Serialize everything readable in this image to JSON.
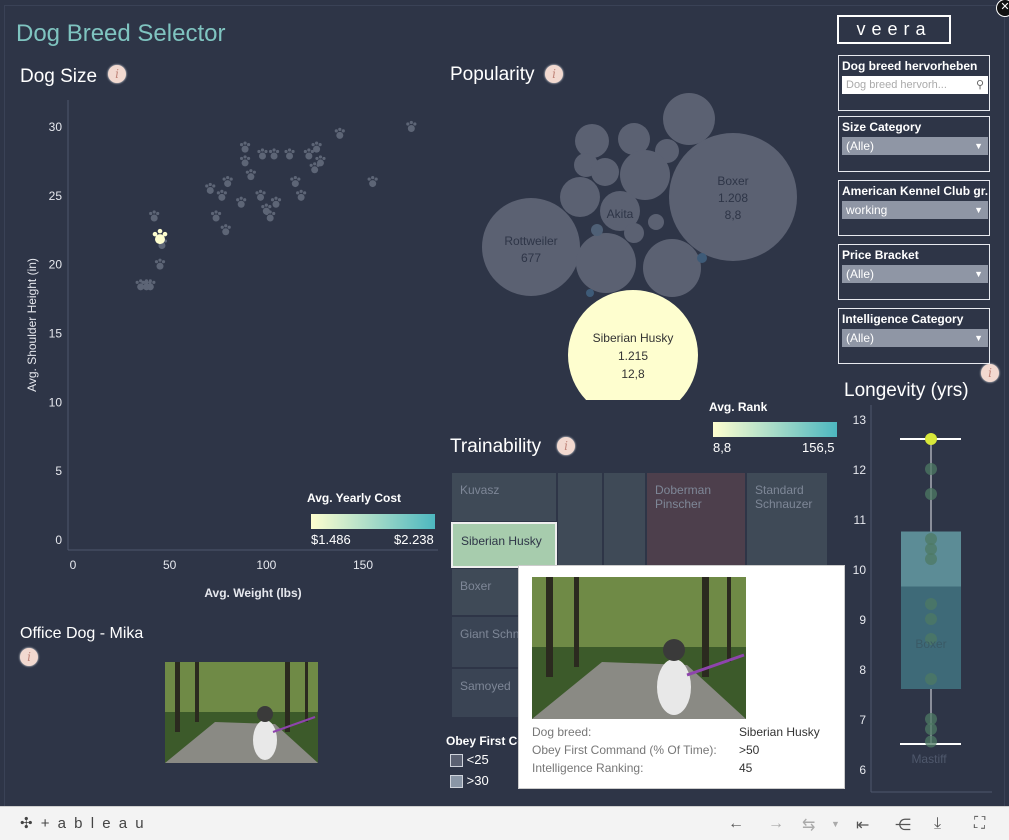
{
  "dashboard": {
    "title": "Dog Breed Selector",
    "logo": "veera"
  },
  "dog_size": {
    "title": "Dog Size",
    "info_icon": "i",
    "xlabel": "Avg. Weight (lbs)",
    "ylabel": "Avg. Shoulder Height (in)",
    "x_ticks": [
      "0",
      "50",
      "100",
      "150"
    ],
    "y_ticks": [
      "0",
      "5",
      "10",
      "15",
      "20",
      "25",
      "30"
    ],
    "legend_title": "Avg. Yearly Cost",
    "legend_min": "$1.486",
    "legend_max": "$2.238"
  },
  "chart_data": [
    {
      "type": "scatter",
      "xlabel": "Avg. Weight (lbs)",
      "ylabel": "Avg. Shoulder Height (in)",
      "xlim": [
        0,
        185
      ],
      "ylim": [
        0,
        31
      ],
      "highlighted": {
        "x": 45,
        "y": 22
      },
      "points": [
        {
          "x": 35,
          "y": 18.5
        },
        {
          "x": 38,
          "y": 18.5
        },
        {
          "x": 40,
          "y": 18.5
        },
        {
          "x": 45,
          "y": 20
        },
        {
          "x": 46,
          "y": 21.5
        },
        {
          "x": 42,
          "y": 23.5
        },
        {
          "x": 74,
          "y": 23.5
        },
        {
          "x": 77,
          "y": 25
        },
        {
          "x": 80,
          "y": 26
        },
        {
          "x": 79,
          "y": 22.5
        },
        {
          "x": 87,
          "y": 24.5
        },
        {
          "x": 92,
          "y": 26.5
        },
        {
          "x": 97,
          "y": 25
        },
        {
          "x": 100,
          "y": 24
        },
        {
          "x": 102,
          "y": 23.5
        },
        {
          "x": 105,
          "y": 24.5
        },
        {
          "x": 98,
          "y": 28
        },
        {
          "x": 104,
          "y": 28
        },
        {
          "x": 89,
          "y": 28.5
        },
        {
          "x": 89,
          "y": 27.5
        },
        {
          "x": 112,
          "y": 28
        },
        {
          "x": 115,
          "y": 26
        },
        {
          "x": 118,
          "y": 25
        },
        {
          "x": 122,
          "y": 28
        },
        {
          "x": 125,
          "y": 27
        },
        {
          "x": 128,
          "y": 27.5
        },
        {
          "x": 126,
          "y": 28.5
        },
        {
          "x": 138,
          "y": 29.5
        },
        {
          "x": 155,
          "y": 26
        },
        {
          "x": 175,
          "y": 30
        },
        {
          "x": 71,
          "y": 25.5
        }
      ]
    },
    {
      "type": "bubble",
      "title": "Popularity",
      "color_legend": "Avg. Rank",
      "color_min": "8,8",
      "color_max": "156,5",
      "labeled": [
        {
          "name": "Boxer",
          "value": "1.208",
          "rank": "8,8"
        },
        {
          "name": "Rottweiler",
          "value": "677"
        },
        {
          "name": "Akita"
        },
        {
          "name": "Siberian Husky",
          "value": "1.215",
          "rank": "12,8"
        }
      ]
    },
    {
      "type": "box",
      "title": "Longevity (yrs)",
      "ylim": [
        5.7,
        13.1
      ],
      "y_ticks": [
        "6",
        "7",
        "8",
        "9",
        "10",
        "11",
        "12",
        "13"
      ],
      "whisker_low": 6.5,
      "whisker_high": 12.6,
      "q1": 7.6,
      "median": 9.65,
      "q3": 10.75,
      "highlighted": 12.6,
      "points": [
        6.55,
        6.8,
        7.0,
        7.8,
        8.6,
        9.0,
        9.3,
        10.2,
        10.4,
        10.6,
        11.5,
        12.0
      ],
      "labels": [
        "Boxer",
        "Mastiff"
      ]
    }
  ],
  "popularity": {
    "title": "Popularity",
    "info_icon": "i",
    "legend_title": "Avg. Rank",
    "legend_min": "8,8",
    "legend_max": "156,5"
  },
  "trainability": {
    "title": "Trainability",
    "info_icon": "i",
    "cells": [
      "Kuvasz",
      "Doberman Pinscher",
      "Standard Schnauzer",
      "Siberian Husky",
      "Boxer",
      "Giant Schn",
      "Samoyed"
    ],
    "legend_title": "Obey First Co",
    "legend_items": [
      "<25",
      ">30"
    ]
  },
  "longevity": {
    "title": "Longevity (yrs)",
    "info_icon": "i"
  },
  "office_dog": {
    "title": "Office Dog - Mika",
    "info_icon": "i"
  },
  "filters": [
    {
      "label": "Dog breed hervorheben",
      "placeholder": "Dog breed hervorh...",
      "type": "search"
    },
    {
      "label": "Size Category",
      "value": "(Alle)"
    },
    {
      "label": "American Kennel Club gr...",
      "value": "working"
    },
    {
      "label": "Price Bracket",
      "value": "(Alle)"
    },
    {
      "label": "Intelligence Category",
      "value": "(Alle)"
    }
  ],
  "tooltip": {
    "rows": [
      {
        "label": "Dog breed:",
        "value": "Siberian Husky"
      },
      {
        "label": "Obey First Command (% Of Time):",
        "value": ">50"
      },
      {
        "label": "Intelligence Ranking:",
        "value": "45"
      }
    ]
  },
  "footer": {
    "brand": "+ a b l e a u"
  },
  "colors": {
    "background": "#2e3547",
    "accent": "#7fc4c0",
    "highlight": "#fefecf",
    "teal": "#4db7c0"
  }
}
